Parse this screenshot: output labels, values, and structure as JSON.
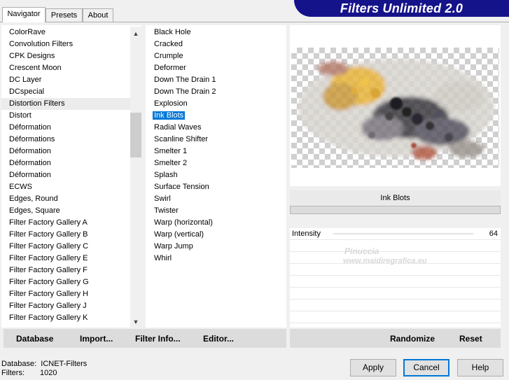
{
  "tabs": [
    {
      "label": "Navigator",
      "active": true
    },
    {
      "label": "Presets",
      "active": false
    },
    {
      "label": "About",
      "active": false
    }
  ],
  "brand": "Filters Unlimited 2.0",
  "categories": [
    "ColorRave",
    "Convolution Filters",
    "CPK Designs",
    "Crescent Moon",
    "DC Layer",
    "DCspecial",
    "Distortion Filters",
    "Distort",
    "Déformation",
    "Déformations",
    "Déformation",
    "Déformation",
    "Déformation",
    "ECWS",
    "Edges, Round",
    "Edges, Square",
    "Filter Factory Gallery A",
    "Filter Factory Gallery B",
    "Filter Factory Gallery C",
    "Filter Factory Gallery E",
    "Filter Factory Gallery F",
    "Filter Factory Gallery G",
    "Filter Factory Gallery H",
    "Filter Factory Gallery J",
    "Filter Factory Gallery K"
  ],
  "selected_category": "Distortion Filters",
  "filters": [
    "Black Hole",
    "Cracked",
    "Crumple",
    "Deformer",
    "Down The Drain 1",
    "Down The Drain 2",
    "Explosion",
    "Ink Blots",
    "Radial Waves",
    "Scanline Shifter",
    "Smelter 1",
    "Smelter 2",
    "Splash",
    "Surface Tension",
    "Swirl",
    "Twister",
    "Warp (horizontal)",
    "Warp (vertical)",
    "Warp Jump",
    "Whirl"
  ],
  "selected_filter": "Ink Blots",
  "preview": {
    "filter_name": "Ink Blots"
  },
  "parameters": [
    {
      "label": "Intensity",
      "value": "64"
    }
  ],
  "watermark": {
    "line1": "Pinuccia",
    "line2": "www.maidiregrafica.eu"
  },
  "left_toolbar": {
    "database": "Database",
    "import": "Import...",
    "filter_info": "Filter Info...",
    "editor": "Editor..."
  },
  "right_toolbar": {
    "randomize": "Randomize",
    "reset": "Reset"
  },
  "status": {
    "database_label": "Database:",
    "database_value": "ICNET-Filters",
    "filters_label": "Filters:",
    "filters_value": "1020"
  },
  "buttons": {
    "apply": "Apply",
    "cancel": "Cancel",
    "help": "Help"
  },
  "colors": {
    "selection": "#0078d7",
    "brand_bg": "#15138a"
  }
}
